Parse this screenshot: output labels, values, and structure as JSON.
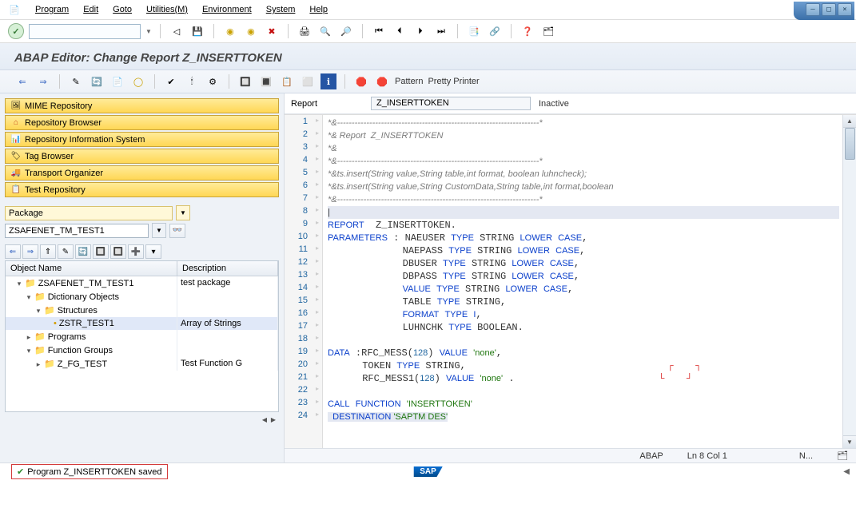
{
  "menu": {
    "program": "Program",
    "edit": "Edit",
    "goto": "Goto",
    "utilities": "Utilities(M)",
    "environment": "Environment",
    "system": "System",
    "help": "Help"
  },
  "title": "ABAP Editor: Change Report Z_INSERTTOKEN",
  "toolbar2": {
    "pattern": "Pattern",
    "pretty": "Pretty Printer"
  },
  "nav": {
    "mime": "MIME Repository",
    "repo_browser": "Repository Browser",
    "repo_info": "Repository Information System",
    "tag_browser": "Tag Browser",
    "transport": "Transport Organizer",
    "test_repo": "Test Repository"
  },
  "pkg": {
    "label": "Package",
    "value": "ZSAFENET_TM_TEST1"
  },
  "tree": {
    "head_name": "Object Name",
    "head_desc": "Description",
    "rows": [
      {
        "indent": 1,
        "exp": "▾",
        "ic": "📁",
        "name": "ZSAFENET_TM_TEST1",
        "desc": "test package"
      },
      {
        "indent": 2,
        "exp": "▾",
        "ic": "📁",
        "name": "Dictionary Objects",
        "desc": ""
      },
      {
        "indent": 3,
        "exp": "▾",
        "ic": "📁",
        "name": "Structures",
        "desc": ""
      },
      {
        "indent": 4,
        "exp": "",
        "ic": "•",
        "name": "ZSTR_TEST1",
        "desc": "Array of Strings"
      },
      {
        "indent": 2,
        "exp": "▸",
        "ic": "📁",
        "name": "Programs",
        "desc": ""
      },
      {
        "indent": 2,
        "exp": "▾",
        "ic": "📁",
        "name": "Function Groups",
        "desc": ""
      },
      {
        "indent": 3,
        "exp": "▸",
        "ic": "📁",
        "name": "Z_FG_TEST",
        "desc": "Test Function G"
      }
    ]
  },
  "report": {
    "label": "Report",
    "value": "Z_INSERTTOKEN",
    "status": "Inactive"
  },
  "code": {
    "lines": [
      {
        "n": 1,
        "cls": "com",
        "txt": "*&---------------------------------------------------------------------*"
      },
      {
        "n": 2,
        "cls": "com",
        "txt": "*& Report  Z_INSERTTOKEN"
      },
      {
        "n": 3,
        "cls": "com",
        "txt": "*&"
      },
      {
        "n": 4,
        "cls": "com",
        "txt": "*&---------------------------------------------------------------------*"
      },
      {
        "n": 5,
        "cls": "com",
        "txt": "*&ts.insert(String value,String table,int format, boolean luhncheck);"
      },
      {
        "n": 6,
        "cls": "com",
        "txt": "*&ts.insert(String value,String CustomData,String table,int format,boolean"
      },
      {
        "n": 7,
        "cls": "com",
        "txt": "*&---------------------------------------------------------------------*"
      }
    ]
  },
  "status_line": {
    "lang": "ABAP",
    "pos": "Ln  8 Col  1",
    "cap": "N..."
  },
  "save_msg": "Program Z_INSERTTOKEN saved",
  "sap": "SAP"
}
